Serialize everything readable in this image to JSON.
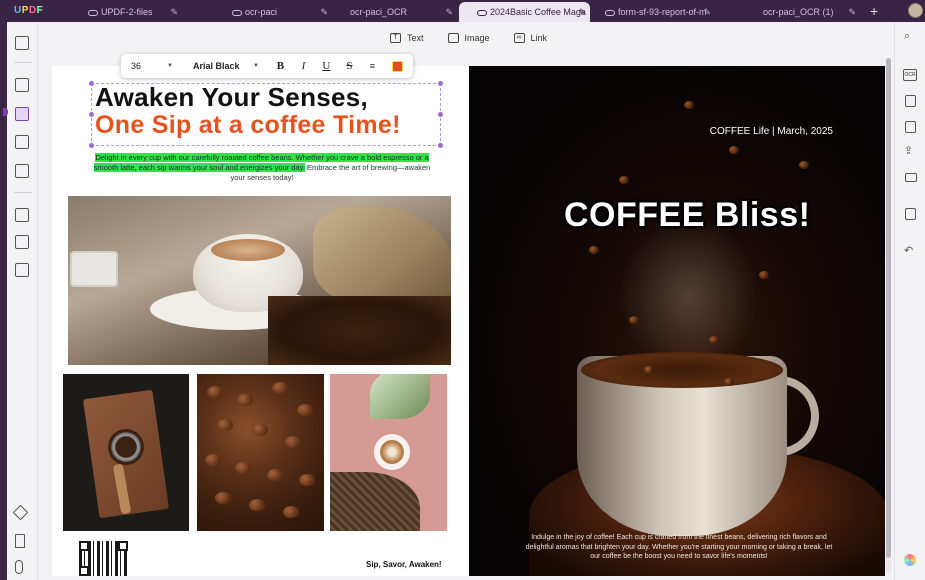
{
  "app": {
    "logo": "UPDF"
  },
  "tabs": [
    {
      "label": "UPDF-2-files",
      "active": false
    },
    {
      "label": "ocr-paci",
      "active": false
    },
    {
      "label": "ocr-paci_OCR",
      "active": false
    },
    {
      "label": "2024Basic Coffee Maga",
      "active": true
    },
    {
      "label": "form-sf-93-report-of-m",
      "active": false
    },
    {
      "label": "ocr-paci_OCR (1)",
      "active": false
    }
  ],
  "edit_toolbar": {
    "text_label": "Text",
    "image_label": "Image",
    "link_label": "Link"
  },
  "format_toolbar": {
    "font_size": "36",
    "font_name": "Arial Black",
    "bold": "B",
    "italic": "I",
    "underline": "U",
    "strike": "S",
    "text_color": "#e24a2b"
  },
  "left_page": {
    "headline_line1": "Awaken Your Senses,",
    "headline_line2": "One Sip at a coffee Time!",
    "intro_highlighted": "Delight in every cup with our carefully roasted coffee beans. Whether you crave a bold espresso or a smooth latte, each sip warms your soul and energizes your day.",
    "intro_rest": " Embrace the art of brewing—awaken your senses today!",
    "tagline": "Sip, Savor, Awaken!"
  },
  "right_page": {
    "issue": "COFFEE Life | March, 2025",
    "title": "COFFEE Bliss!",
    "caption": "Indulge in the joy of coffee! Each cup is crafted from the finest beans, delivering rich flavors and delightful aromas that brighten your day. Whether you're starting your morning or taking a break, let our coffee be the boost you need to savor life's moments!"
  },
  "colors": {
    "accent": "#7b3fb0",
    "headline_orange": "#e6531d",
    "highlight_green": "#33e24b"
  }
}
